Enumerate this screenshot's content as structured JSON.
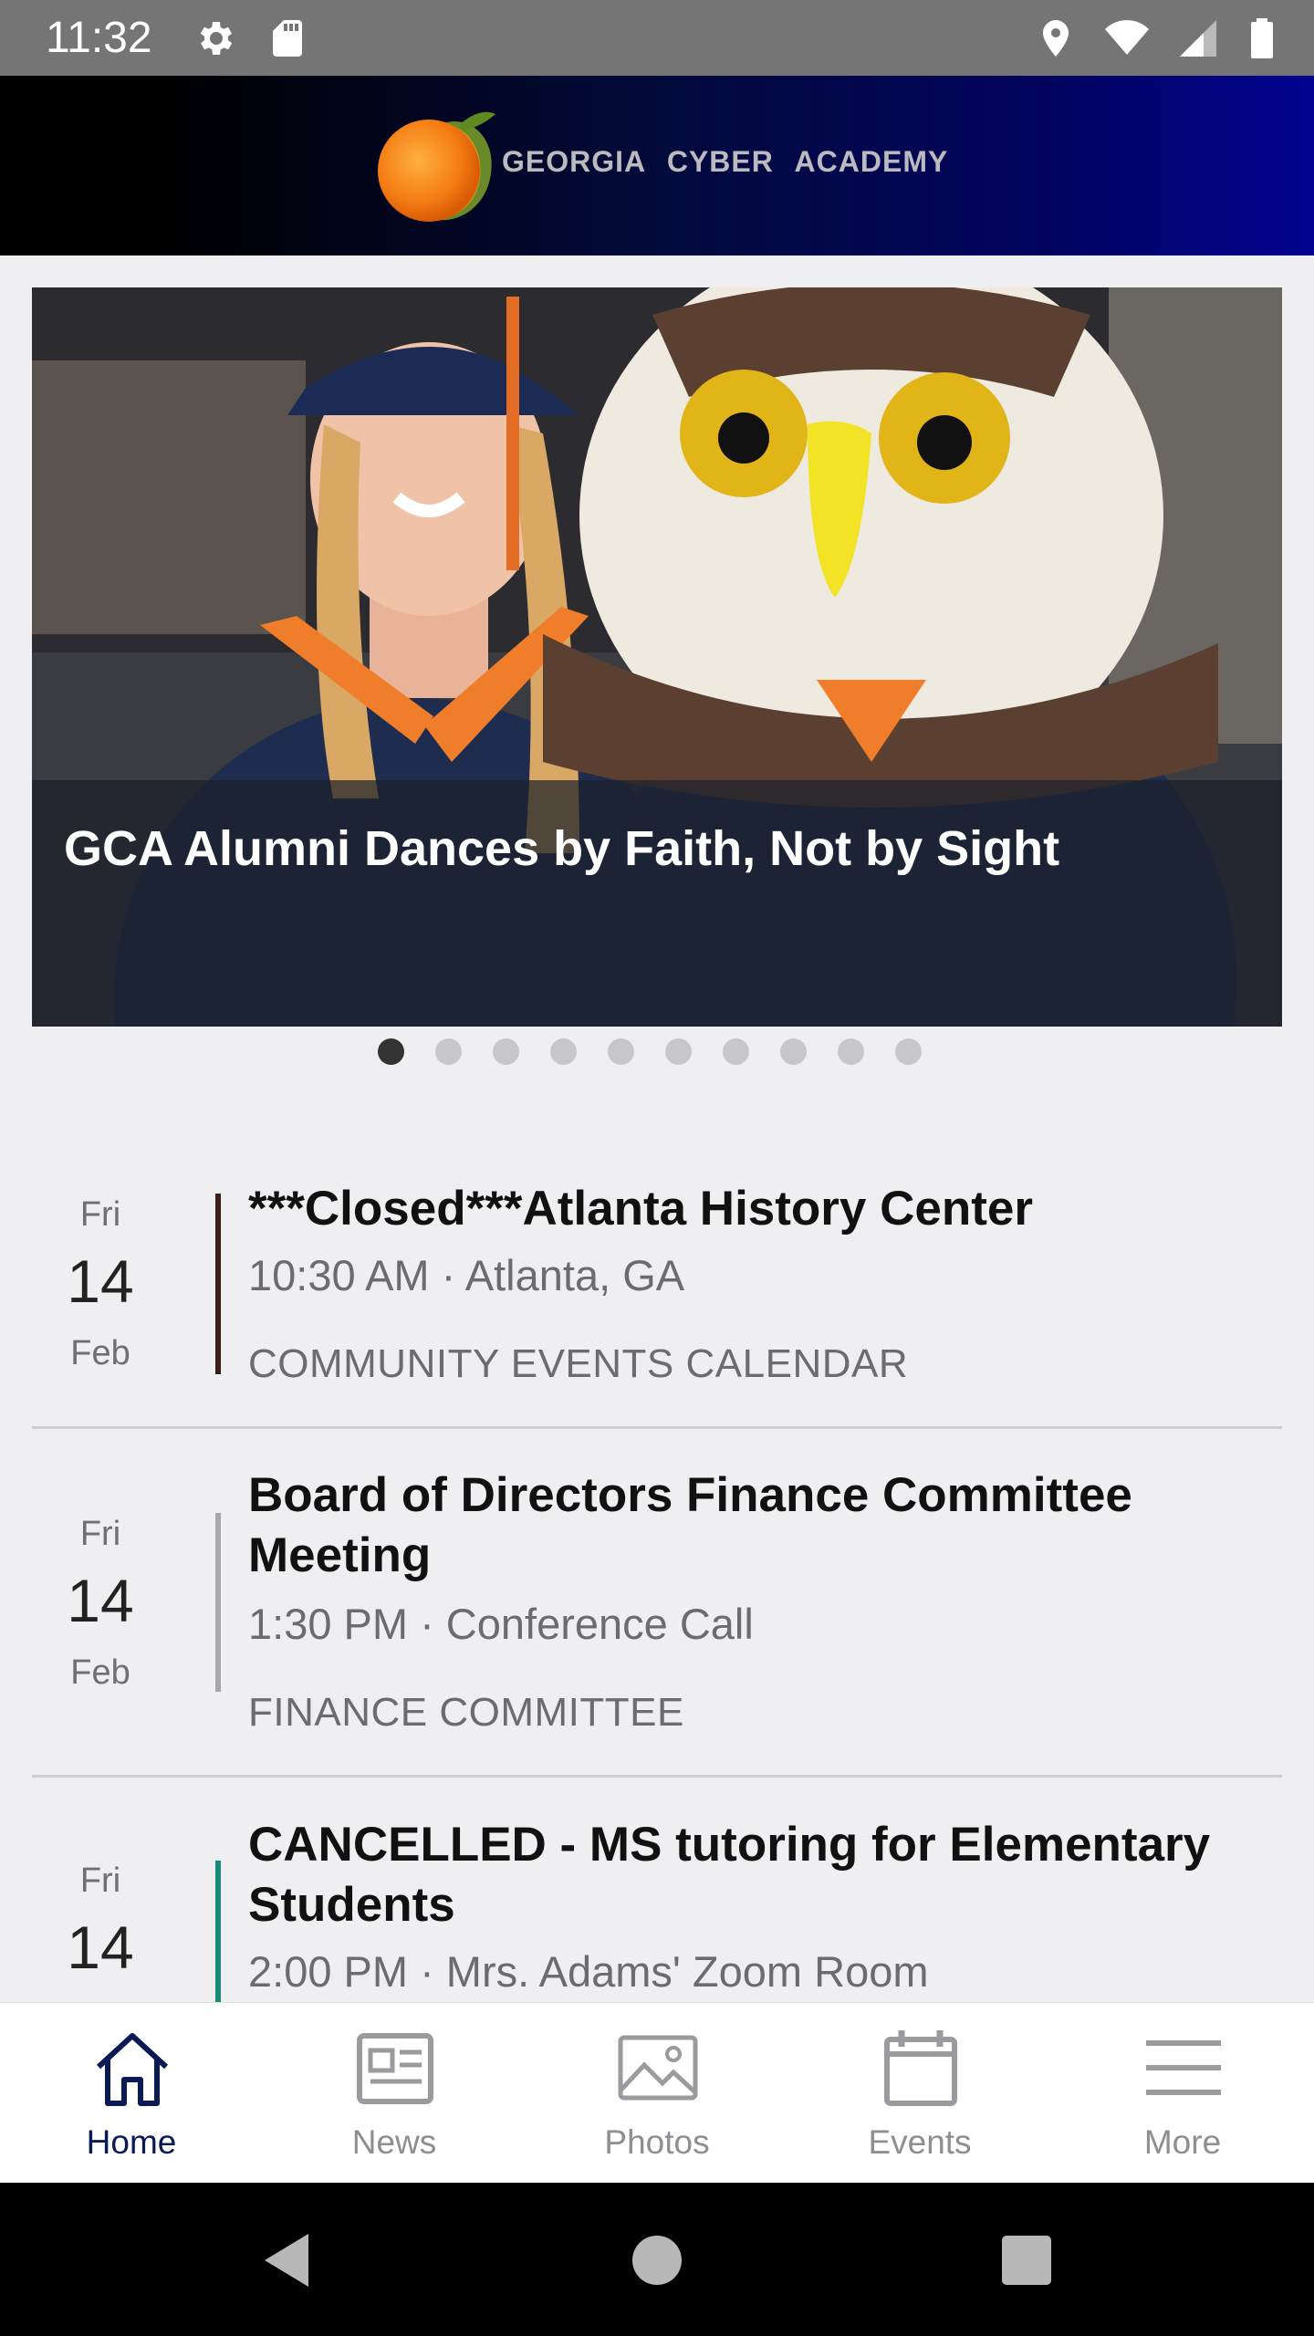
{
  "status_bar": {
    "time": "11:32",
    "left_icons": [
      "gear-icon",
      "sd-card-icon"
    ],
    "right_icons": [
      "location-icon",
      "wifi-icon",
      "signal-icon",
      "battery-icon"
    ]
  },
  "header": {
    "brand": "GEORGIA CYBER ACADEMY",
    "logo": "peach-logo"
  },
  "hero": {
    "caption": "GCA Alumni Dances by Faith, Not by Sight",
    "page_count": 10,
    "active_page": 1
  },
  "events": [
    {
      "day": "Fri",
      "date": "14",
      "month": "Feb",
      "title": "***Closed***Atlanta History Center",
      "time": "10:30 AM · Atlanta, GA",
      "calendar": "COMMUNITY EVENTS CALENDAR",
      "color": "#3a1e17"
    },
    {
      "day": "Fri",
      "date": "14",
      "month": "Feb",
      "title": "Board of Directors Finance Committee Meeting",
      "time": "1:30 PM · Conference Call",
      "calendar": "FINANCE COMMITTEE",
      "color": "#a8a8ac"
    },
    {
      "day": "Fri",
      "date": "14",
      "month": "",
      "title": "CANCELLED - MS tutoring for Elementary Students",
      "time": "2:00 PM · Mrs. Adams' Zoom Room",
      "calendar": "",
      "color": "#1a8a78"
    }
  ],
  "tabs": [
    {
      "label": "Home",
      "icon": "home-icon",
      "active": true
    },
    {
      "label": "News",
      "icon": "news-icon",
      "active": false
    },
    {
      "label": "Photos",
      "icon": "photos-icon",
      "active": false
    },
    {
      "label": "Events",
      "icon": "calendar-icon",
      "active": false
    },
    {
      "label": "More",
      "icon": "menu-icon",
      "active": false
    }
  ],
  "colors": {
    "header_dark": "#000000",
    "header_blue": "#020390",
    "tab_active": "#0a1a55",
    "tab_inactive": "#8e8e93"
  }
}
